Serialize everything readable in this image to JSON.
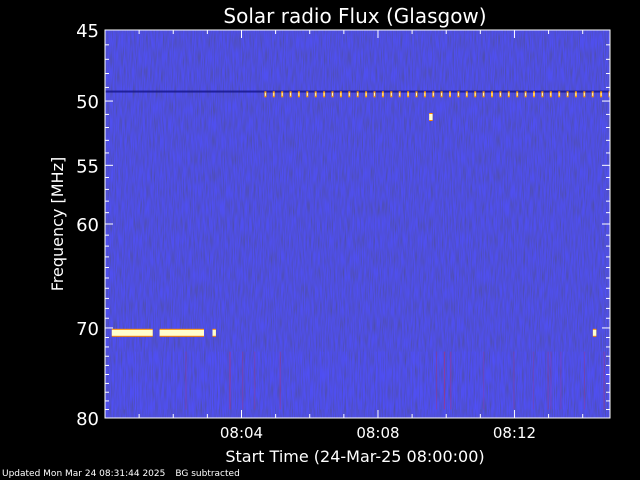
{
  "chart_data": {
    "type": "heatmap",
    "title": "Solar radio Flux (Glasgow)",
    "xlabel": "Start Time (24-Mar-25 08:00:00)",
    "ylabel": "Frequency [MHz]",
    "x_unit": "minutes after 08:00:00",
    "xlim": [
      0,
      14.8
    ],
    "ylim": [
      45,
      80
    ],
    "y_scale": "log",
    "y_axis_inverted": true,
    "x_ticks": [
      {
        "value": 4,
        "label": "08:04"
      },
      {
        "value": 8,
        "label": "08:08"
      },
      {
        "value": 12,
        "label": "08:12"
      }
    ],
    "y_ticks": [
      {
        "value": 45,
        "label": "45"
      },
      {
        "value": 50,
        "label": "50"
      },
      {
        "value": 55,
        "label": "55"
      },
      {
        "value": 60,
        "label": "60"
      },
      {
        "value": 70,
        "label": "70"
      },
      {
        "value": 80,
        "label": "80"
      }
    ],
    "background_color": "#1a1aa0",
    "features": [
      {
        "kind": "interference-band",
        "freq_mhz": 49.5,
        "t_start": 4.7,
        "t_end": 14.8,
        "pattern": "periodic spikes",
        "color": "#ff9900"
      },
      {
        "kind": "spike",
        "freq_mhz": 51.2,
        "t_start": 9.5,
        "t_end": 9.6,
        "color": "#ffffcc"
      },
      {
        "kind": "interference-band",
        "freq_mhz": 70.5,
        "t_start": 0.2,
        "t_end": 1.4,
        "color": "#ffffcc"
      },
      {
        "kind": "interference-band",
        "freq_mhz": 70.5,
        "t_start": 1.6,
        "t_end": 2.9,
        "color": "#ffffcc"
      },
      {
        "kind": "interference-band",
        "freq_mhz": 70.5,
        "t_start": 3.15,
        "t_end": 3.25,
        "color": "#ffffcc"
      },
      {
        "kind": "interference-band",
        "freq_mhz": 70.5,
        "t_start": 14.3,
        "t_end": 14.4,
        "color": "#ffffcc"
      },
      {
        "kind": "striated-region",
        "freq_lo_mhz": 72.5,
        "freq_hi_mhz": 79,
        "t_start": 0.2,
        "t_end": 14.8,
        "color": "#5050ff"
      }
    ]
  },
  "footer": {
    "updated": "Updated Mon Mar 24 08:31:44 2025",
    "note": "BG subtracted"
  }
}
